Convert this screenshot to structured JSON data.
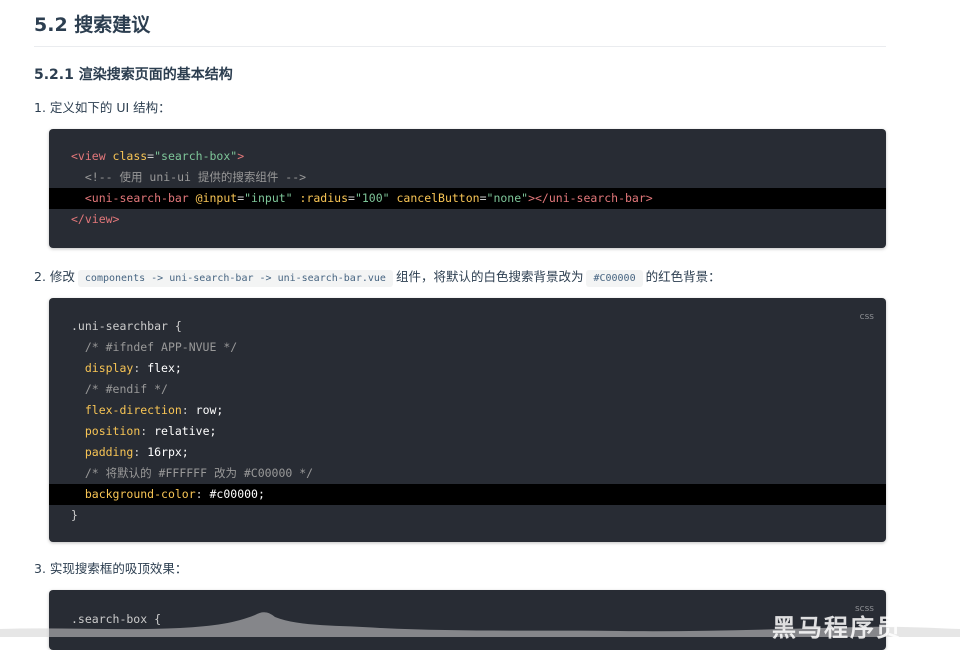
{
  "heading": "5.2 搜索建议",
  "subheading": "5.2.1 渲染搜索页面的基本结构",
  "steps": [
    {
      "text": "1. 定义如下的 UI 结构："
    },
    {
      "prefix": "2. 修改",
      "code1": "components -> uni-search-bar -> uni-search-bar.vue",
      "middle": "组件，将默认的白色搜索背景改为",
      "code2": "#C00000",
      "suffix": "的红色背景："
    },
    {
      "text": "3. 实现搜索框的吸顶效果："
    }
  ],
  "block1": {
    "lines": [
      {
        "open": "<view ",
        "attr": "class",
        "eq": "=",
        "str": "\"search-box\"",
        "close": ">"
      },
      {
        "comment": "<!-- 使用 uni-ui 提供的搜索组件 -->"
      },
      {
        "tag": "<uni-search-bar ",
        "a1": "@input",
        "s1": "\"input\"",
        "a2": ":radius",
        "s2": "\"100\"",
        "a3": "cancelButton",
        "s3": "\"none\"",
        "end": "></uni-search-bar>"
      },
      {
        "close": "</view>"
      }
    ]
  },
  "block2": {
    "lang": "css",
    "selector": ".uni-searchbar {",
    "c1": "/* #ifndef APP-NVUE */",
    "p1": "display",
    "v1": "flex;",
    "c2": "/* #endif */",
    "p2": "flex-direction",
    "v2": "row;",
    "p3": "position",
    "v3": "relative;",
    "p4": "padding",
    "v4": "16rpx;",
    "c3": "/* 将默认的 #FFFFFF 改为 #C00000 */",
    "p5": "background-color",
    "v5": "#c00000;",
    "end": "}"
  },
  "block3": {
    "lang": "scss",
    "line1": ".search-box {"
  },
  "watermark": "黑马程序员",
  "colors": {
    "code_bg": "#282c34",
    "tag": "#e2777a",
    "attr": "#f8c555",
    "string": "#7ec699"
  }
}
